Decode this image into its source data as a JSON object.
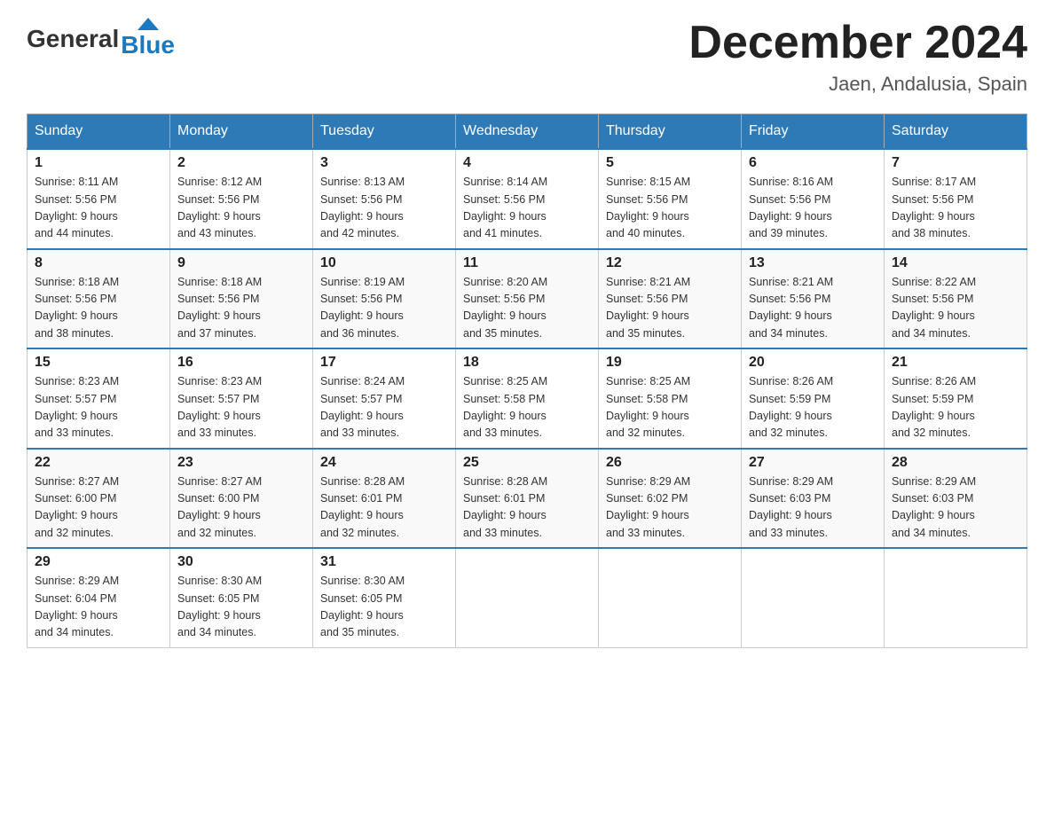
{
  "header": {
    "logo_general": "General",
    "logo_blue": "Blue",
    "title": "December 2024",
    "subtitle": "Jaen, Andalusia, Spain"
  },
  "calendar": {
    "headers": [
      "Sunday",
      "Monday",
      "Tuesday",
      "Wednesday",
      "Thursday",
      "Friday",
      "Saturday"
    ],
    "weeks": [
      [
        {
          "day": "1",
          "sunrise": "Sunrise: 8:11 AM",
          "sunset": "Sunset: 5:56 PM",
          "daylight": "Daylight: 9 hours and 44 minutes."
        },
        {
          "day": "2",
          "sunrise": "Sunrise: 8:12 AM",
          "sunset": "Sunset: 5:56 PM",
          "daylight": "Daylight: 9 hours and 43 minutes."
        },
        {
          "day": "3",
          "sunrise": "Sunrise: 8:13 AM",
          "sunset": "Sunset: 5:56 PM",
          "daylight": "Daylight: 9 hours and 42 minutes."
        },
        {
          "day": "4",
          "sunrise": "Sunrise: 8:14 AM",
          "sunset": "Sunset: 5:56 PM",
          "daylight": "Daylight: 9 hours and 41 minutes."
        },
        {
          "day": "5",
          "sunrise": "Sunrise: 8:15 AM",
          "sunset": "Sunset: 5:56 PM",
          "daylight": "Daylight: 9 hours and 40 minutes."
        },
        {
          "day": "6",
          "sunrise": "Sunrise: 8:16 AM",
          "sunset": "Sunset: 5:56 PM",
          "daylight": "Daylight: 9 hours and 39 minutes."
        },
        {
          "day": "7",
          "sunrise": "Sunrise: 8:17 AM",
          "sunset": "Sunset: 5:56 PM",
          "daylight": "Daylight: 9 hours and 38 minutes."
        }
      ],
      [
        {
          "day": "8",
          "sunrise": "Sunrise: 8:18 AM",
          "sunset": "Sunset: 5:56 PM",
          "daylight": "Daylight: 9 hours and 38 minutes."
        },
        {
          "day": "9",
          "sunrise": "Sunrise: 8:18 AM",
          "sunset": "Sunset: 5:56 PM",
          "daylight": "Daylight: 9 hours and 37 minutes."
        },
        {
          "day": "10",
          "sunrise": "Sunrise: 8:19 AM",
          "sunset": "Sunset: 5:56 PM",
          "daylight": "Daylight: 9 hours and 36 minutes."
        },
        {
          "day": "11",
          "sunrise": "Sunrise: 8:20 AM",
          "sunset": "Sunset: 5:56 PM",
          "daylight": "Daylight: 9 hours and 35 minutes."
        },
        {
          "day": "12",
          "sunrise": "Sunrise: 8:21 AM",
          "sunset": "Sunset: 5:56 PM",
          "daylight": "Daylight: 9 hours and 35 minutes."
        },
        {
          "day": "13",
          "sunrise": "Sunrise: 8:21 AM",
          "sunset": "Sunset: 5:56 PM",
          "daylight": "Daylight: 9 hours and 34 minutes."
        },
        {
          "day": "14",
          "sunrise": "Sunrise: 8:22 AM",
          "sunset": "Sunset: 5:56 PM",
          "daylight": "Daylight: 9 hours and 34 minutes."
        }
      ],
      [
        {
          "day": "15",
          "sunrise": "Sunrise: 8:23 AM",
          "sunset": "Sunset: 5:57 PM",
          "daylight": "Daylight: 9 hours and 33 minutes."
        },
        {
          "day": "16",
          "sunrise": "Sunrise: 8:23 AM",
          "sunset": "Sunset: 5:57 PM",
          "daylight": "Daylight: 9 hours and 33 minutes."
        },
        {
          "day": "17",
          "sunrise": "Sunrise: 8:24 AM",
          "sunset": "Sunset: 5:57 PM",
          "daylight": "Daylight: 9 hours and 33 minutes."
        },
        {
          "day": "18",
          "sunrise": "Sunrise: 8:25 AM",
          "sunset": "Sunset: 5:58 PM",
          "daylight": "Daylight: 9 hours and 33 minutes."
        },
        {
          "day": "19",
          "sunrise": "Sunrise: 8:25 AM",
          "sunset": "Sunset: 5:58 PM",
          "daylight": "Daylight: 9 hours and 32 minutes."
        },
        {
          "day": "20",
          "sunrise": "Sunrise: 8:26 AM",
          "sunset": "Sunset: 5:59 PM",
          "daylight": "Daylight: 9 hours and 32 minutes."
        },
        {
          "day": "21",
          "sunrise": "Sunrise: 8:26 AM",
          "sunset": "Sunset: 5:59 PM",
          "daylight": "Daylight: 9 hours and 32 minutes."
        }
      ],
      [
        {
          "day": "22",
          "sunrise": "Sunrise: 8:27 AM",
          "sunset": "Sunset: 6:00 PM",
          "daylight": "Daylight: 9 hours and 32 minutes."
        },
        {
          "day": "23",
          "sunrise": "Sunrise: 8:27 AM",
          "sunset": "Sunset: 6:00 PM",
          "daylight": "Daylight: 9 hours and 32 minutes."
        },
        {
          "day": "24",
          "sunrise": "Sunrise: 8:28 AM",
          "sunset": "Sunset: 6:01 PM",
          "daylight": "Daylight: 9 hours and 32 minutes."
        },
        {
          "day": "25",
          "sunrise": "Sunrise: 8:28 AM",
          "sunset": "Sunset: 6:01 PM",
          "daylight": "Daylight: 9 hours and 33 minutes."
        },
        {
          "day": "26",
          "sunrise": "Sunrise: 8:29 AM",
          "sunset": "Sunset: 6:02 PM",
          "daylight": "Daylight: 9 hours and 33 minutes."
        },
        {
          "day": "27",
          "sunrise": "Sunrise: 8:29 AM",
          "sunset": "Sunset: 6:03 PM",
          "daylight": "Daylight: 9 hours and 33 minutes."
        },
        {
          "day": "28",
          "sunrise": "Sunrise: 8:29 AM",
          "sunset": "Sunset: 6:03 PM",
          "daylight": "Daylight: 9 hours and 34 minutes."
        }
      ],
      [
        {
          "day": "29",
          "sunrise": "Sunrise: 8:29 AM",
          "sunset": "Sunset: 6:04 PM",
          "daylight": "Daylight: 9 hours and 34 minutes."
        },
        {
          "day": "30",
          "sunrise": "Sunrise: 8:30 AM",
          "sunset": "Sunset: 6:05 PM",
          "daylight": "Daylight: 9 hours and 34 minutes."
        },
        {
          "day": "31",
          "sunrise": "Sunrise: 8:30 AM",
          "sunset": "Sunset: 6:05 PM",
          "daylight": "Daylight: 9 hours and 35 minutes."
        },
        null,
        null,
        null,
        null
      ]
    ]
  }
}
